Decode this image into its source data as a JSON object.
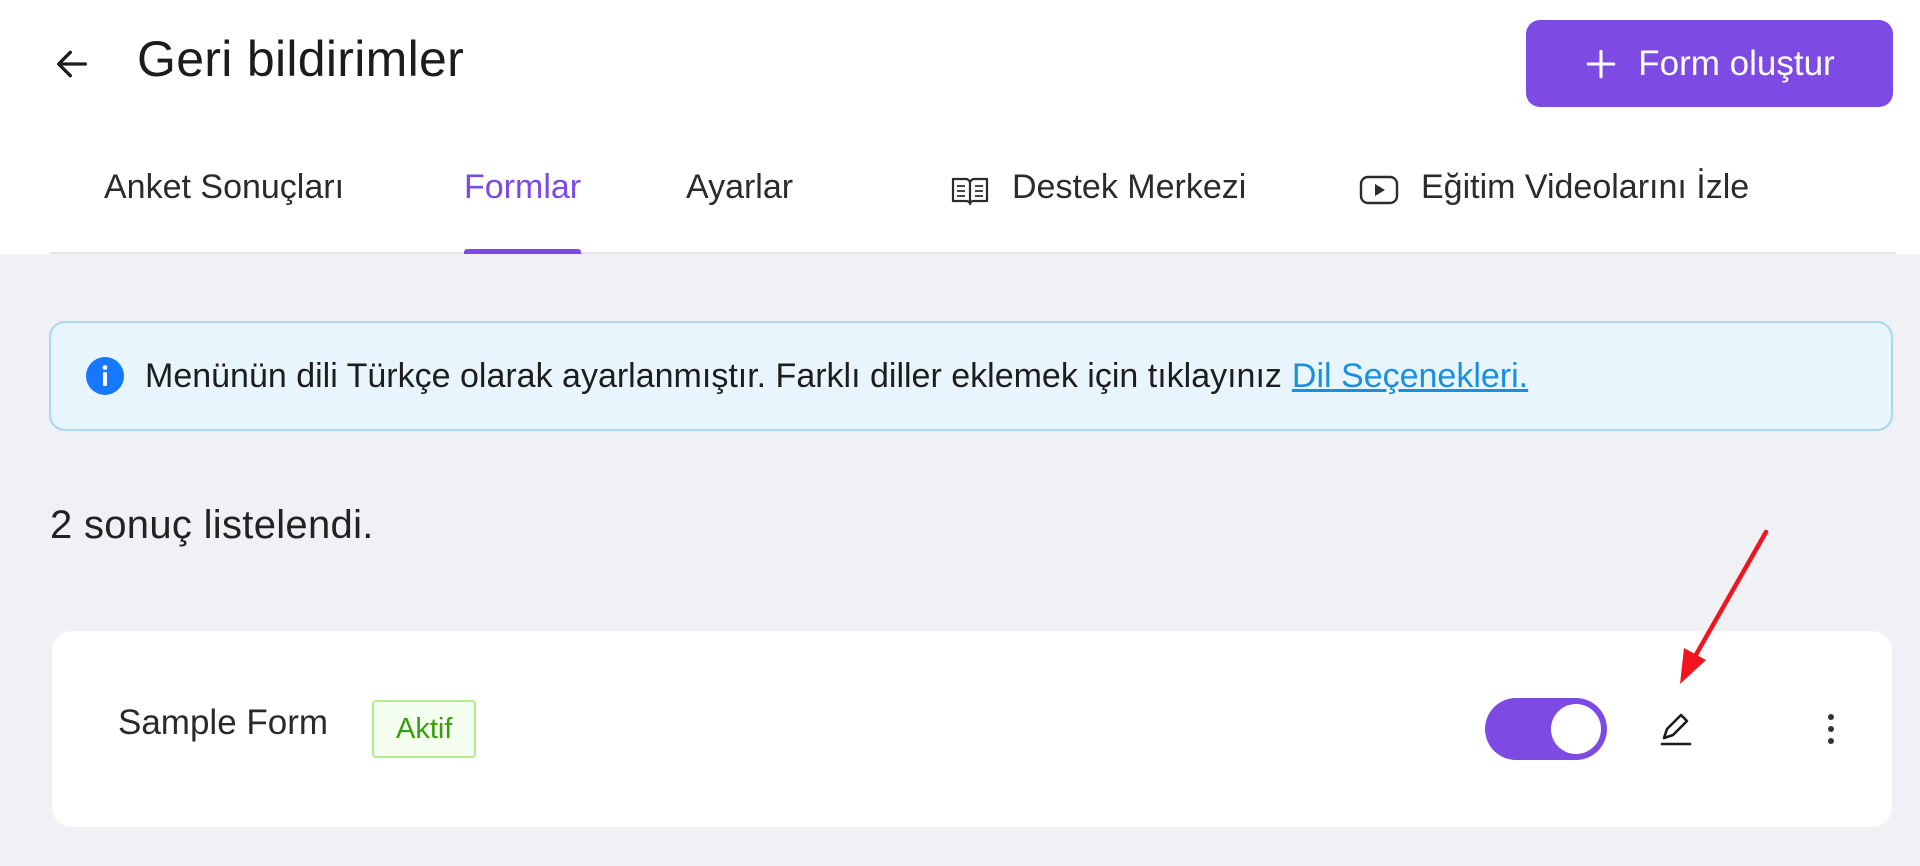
{
  "header": {
    "title": "Geri bildirimler",
    "create_button_label": "Form oluştur"
  },
  "tabs": [
    {
      "label": "Anket Sonuçları",
      "active": false
    },
    {
      "label": "Formlar",
      "active": true
    },
    {
      "label": "Ayarlar",
      "active": false
    },
    {
      "label": "Destek Merkezi",
      "active": false,
      "icon": "book-icon"
    },
    {
      "label": "Eğitim Videolarını İzle",
      "active": false,
      "icon": "video-play-icon"
    }
  ],
  "info_banner": {
    "text": "Menünün dili Türkçe olarak ayarlanmıştır. Farklı diller eklemek için tıklayınız",
    "link_label": "Dil Seçenekleri."
  },
  "results_count": "2 sonuç listelendi.",
  "forms": [
    {
      "name": "Sample Form",
      "status": "Aktif",
      "enabled": true
    }
  ],
  "colors": {
    "accent": "#7d4ae3",
    "info_background": "#e8f5fd",
    "link": "#1a8fe0",
    "status_active": "#389e0d",
    "annotation_arrow": "#f0141e"
  }
}
